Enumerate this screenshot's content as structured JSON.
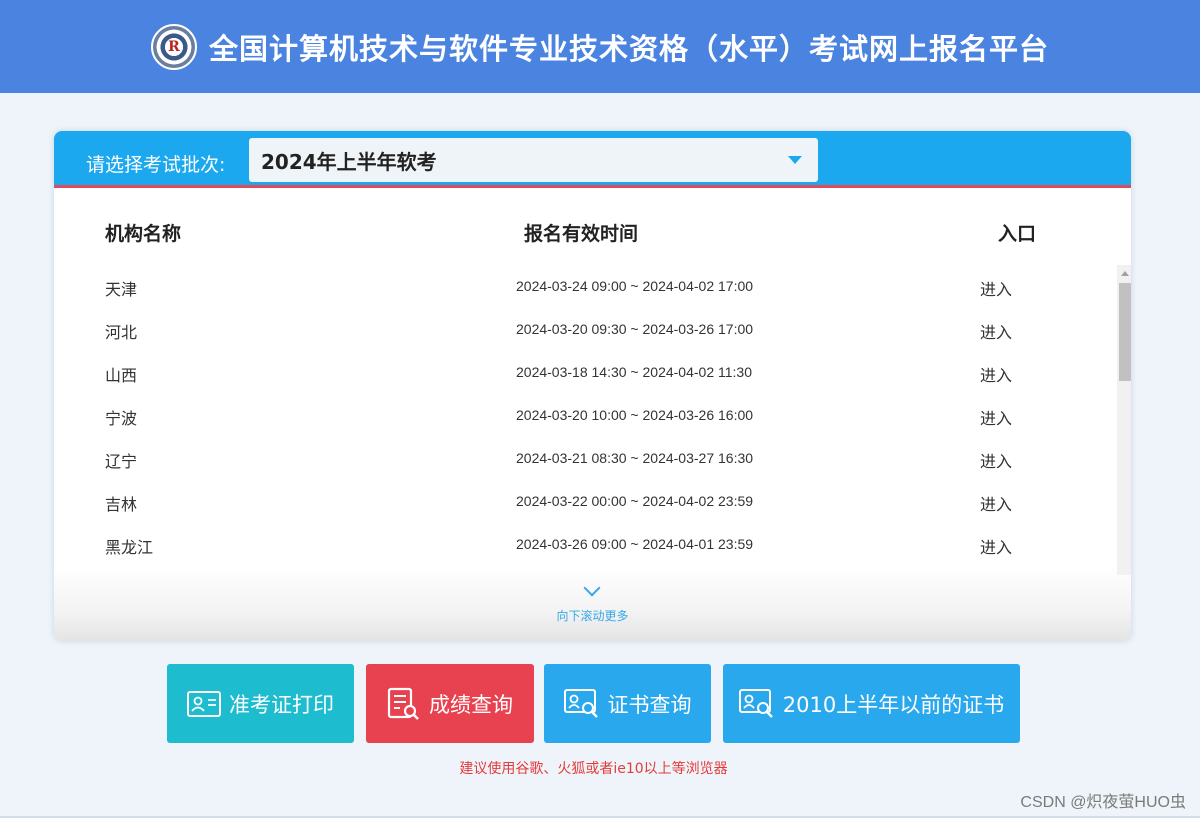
{
  "header": {
    "logo_text": "R",
    "title": "全国计算机技术与软件专业技术资格（水平）考试网上报名平台"
  },
  "batch": {
    "label": "请选择考试批次:",
    "selected": "2024年上半年软考"
  },
  "table": {
    "columns": [
      "机构名称",
      "报名有效时间",
      "入口"
    ],
    "rows": [
      {
        "org": "天津",
        "time": "2024-03-24 09:00 ~ 2024-04-02 17:00",
        "entry": "进入"
      },
      {
        "org": "河北",
        "time": "2024-03-20 09:30 ~ 2024-03-26 17:00",
        "entry": "进入"
      },
      {
        "org": "山西",
        "time": "2024-03-18 14:30 ~ 2024-04-02 11:30",
        "entry": "进入"
      },
      {
        "org": "宁波",
        "time": "2024-03-20 10:00 ~ 2024-03-26 16:00",
        "entry": "进入"
      },
      {
        "org": "辽宁",
        "time": "2024-03-21 08:30 ~ 2024-03-27 16:30",
        "entry": "进入"
      },
      {
        "org": "吉林",
        "time": "2024-03-22 00:00 ~ 2024-04-02 23:59",
        "entry": "进入"
      },
      {
        "org": "黑龙江",
        "time": "2024-03-26 09:00 ~ 2024-04-01 23:59",
        "entry": "进入"
      }
    ],
    "scroll_more": "向下滚动更多"
  },
  "buttons": {
    "admit": {
      "label": "准考证打印",
      "icon": "id-card-icon",
      "color": "#1dbccf"
    },
    "score": {
      "label": "成绩查询",
      "icon": "document-search-icon",
      "color": "#e8414f"
    },
    "cert": {
      "label": "证书查询",
      "icon": "certificate-search-icon",
      "color": "#2aa8ee"
    },
    "old_cert": {
      "label": "2010上半年以前的证书",
      "icon": "certificate-search-icon",
      "color": "#2aa8ee"
    }
  },
  "notice": "建议使用谷歌、火狐或者ie10以上等浏览器",
  "watermark": "CSDN @炽夜萤HUO虫",
  "colors": {
    "header_bg": "#4a84e0",
    "panel_head_bg": "#1ba8ef",
    "accent_red": "#e04a5a",
    "notice_red": "#e33c3c"
  }
}
